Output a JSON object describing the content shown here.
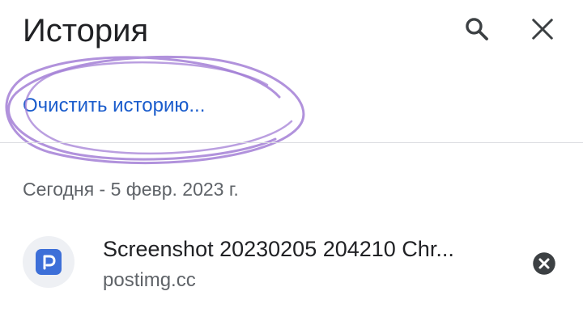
{
  "header": {
    "title": "История",
    "search_icon": "search-icon",
    "close_icon": "close-icon"
  },
  "actions": {
    "clear_history_label": "Очистить историю..."
  },
  "annotation": {
    "color": "#a37fd6"
  },
  "history": {
    "date_header": "Сегодня - 5 февр. 2023 г.",
    "items": [
      {
        "title": "Screenshot 20230205 204210 Chr...",
        "url": "postimg.cc",
        "favicon_icon": "postimg-favicon-icon",
        "favicon_color": "#3d6fd8",
        "remove_icon": "remove-circle-icon"
      }
    ]
  },
  "colors": {
    "link": "#1a5ccc",
    "text_primary": "#202124",
    "text_secondary": "#5f6368",
    "divider": "#dadce0"
  }
}
